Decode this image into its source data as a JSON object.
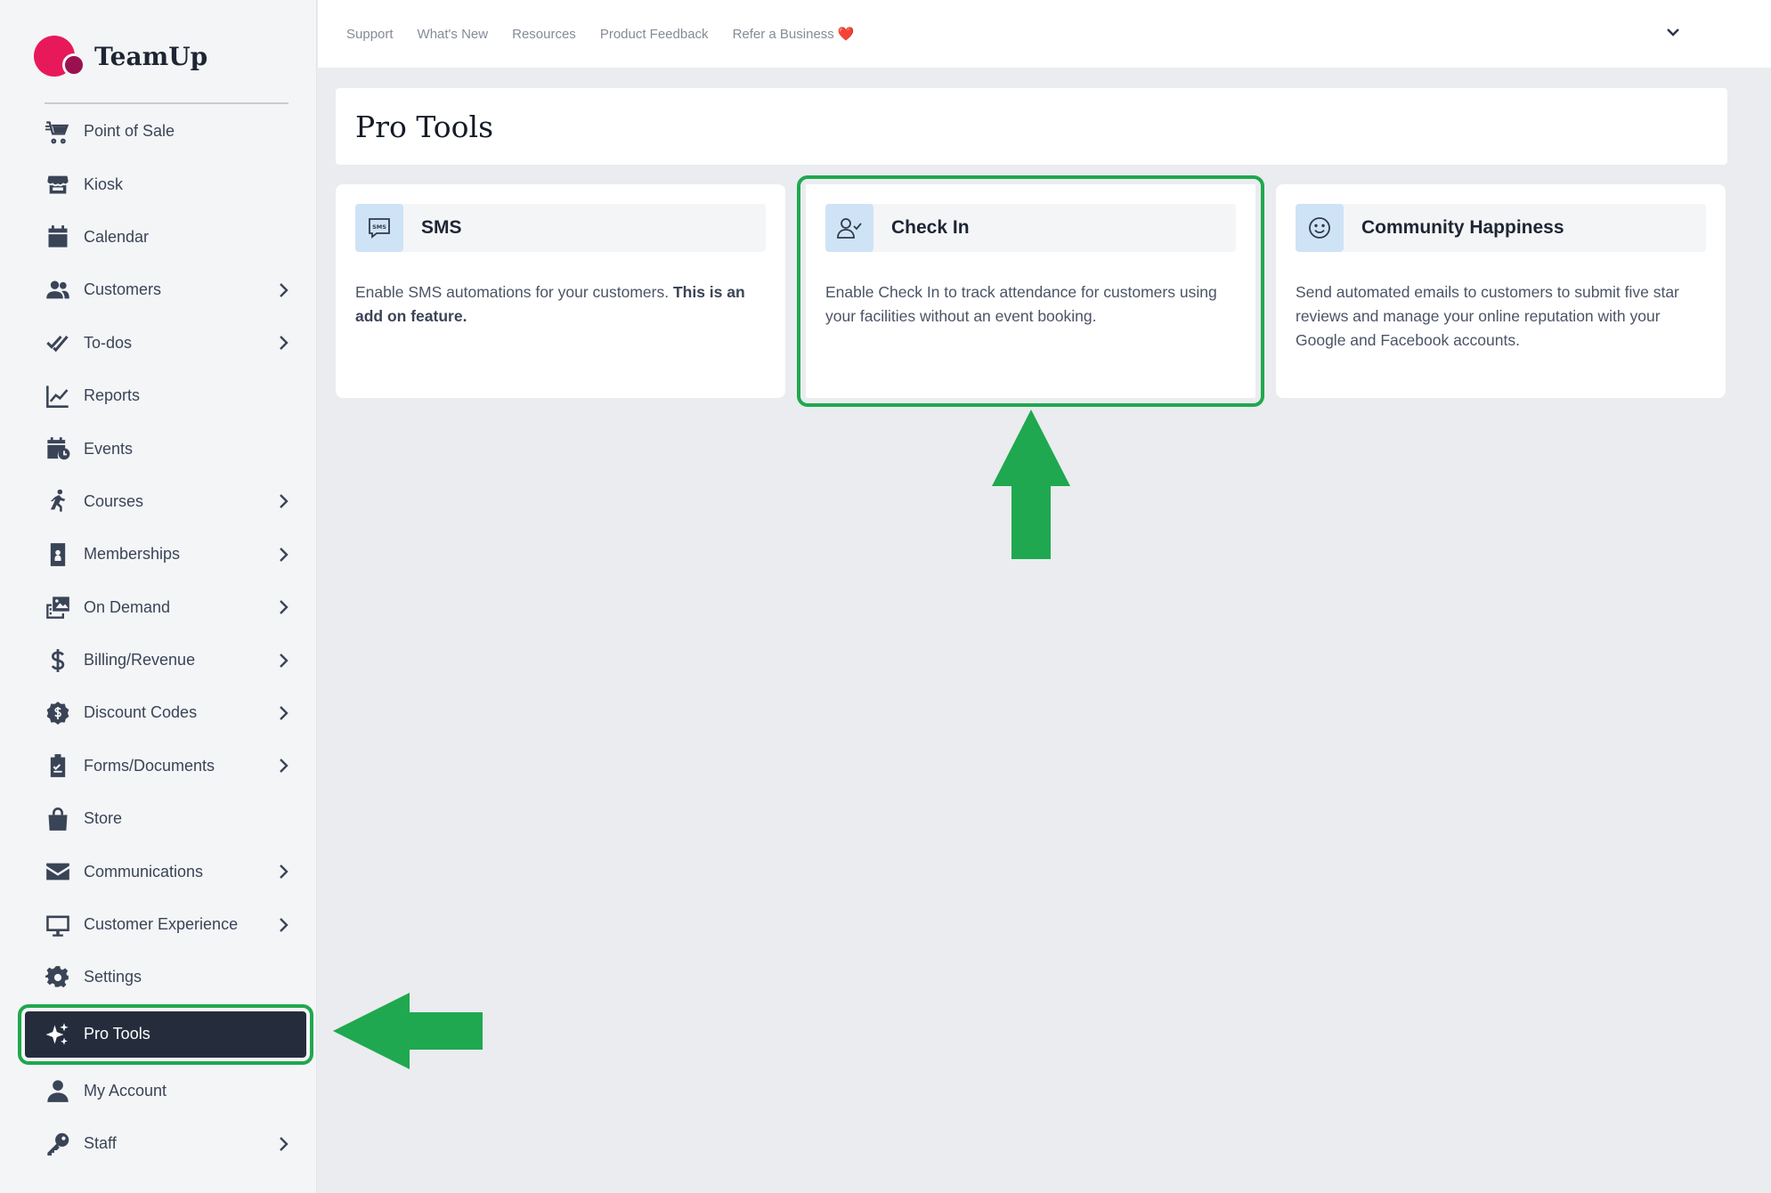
{
  "app": {
    "name": "TeamUp"
  },
  "colors": {
    "accent": "#1fa84f",
    "brand_primary": "#e8195a",
    "brand_secondary": "#9b1150",
    "active_nav": "#252d3d"
  },
  "sidebar": {
    "items": [
      {
        "label": "Point of Sale",
        "icon": "cart-icon",
        "chevron": false
      },
      {
        "label": "Kiosk",
        "icon": "storefront-icon",
        "chevron": false
      },
      {
        "label": "Calendar",
        "icon": "calendar-icon",
        "chevron": false
      },
      {
        "label": "Customers",
        "icon": "users-icon",
        "chevron": true
      },
      {
        "label": "To-dos",
        "icon": "double-check-icon",
        "chevron": true
      },
      {
        "label": "Reports",
        "icon": "line-chart-icon",
        "chevron": false
      },
      {
        "label": "Events",
        "icon": "calendar-clock-icon",
        "chevron": false
      },
      {
        "label": "Courses",
        "icon": "running-person-icon",
        "chevron": true
      },
      {
        "label": "Memberships",
        "icon": "id-badge-icon",
        "chevron": true
      },
      {
        "label": "On Demand",
        "icon": "video-gallery-icon",
        "chevron": true
      },
      {
        "label": "Billing/Revenue",
        "icon": "dollar-icon",
        "chevron": true
      },
      {
        "label": "Discount Codes",
        "icon": "discount-badge-icon",
        "chevron": true
      },
      {
        "label": "Forms/Documents",
        "icon": "clipboard-icon",
        "chevron": true
      },
      {
        "label": "Store",
        "icon": "shopping-bag-icon",
        "chevron": false
      },
      {
        "label": "Communications",
        "icon": "envelope-icon",
        "chevron": true
      },
      {
        "label": "Customer Experience",
        "icon": "monitor-icon",
        "chevron": true
      },
      {
        "label": "Settings",
        "icon": "gear-icon",
        "chevron": false
      },
      {
        "label": "Pro Tools",
        "icon": "sparkles-icon",
        "chevron": false,
        "active": true
      },
      {
        "label": "My Account",
        "icon": "person-icon",
        "chevron": false
      },
      {
        "label": "Staff",
        "icon": "key-icon",
        "chevron": true
      }
    ]
  },
  "topbar": {
    "links": [
      "Support",
      "What's New",
      "Resources",
      "Product Feedback",
      "Refer a Business"
    ],
    "heart": "❤️"
  },
  "page": {
    "title": "Pro Tools"
  },
  "cards": [
    {
      "title": "SMS",
      "desc_plain": "Enable SMS automations for your customers. ",
      "desc_bold": "This is an add on feature.",
      "icon": "sms-icon"
    },
    {
      "title": "Check In",
      "desc_plain": "Enable Check In to track attendance for customers using your facilities without an event booking.",
      "desc_bold": "",
      "icon": "user-check-icon"
    },
    {
      "title": "Community Happiness",
      "desc_plain": "Send automated emails to customers to submit five star reviews and manage your online reputation with your Google and Facebook accounts.",
      "desc_bold": "",
      "icon": "smiley-icon"
    }
  ]
}
